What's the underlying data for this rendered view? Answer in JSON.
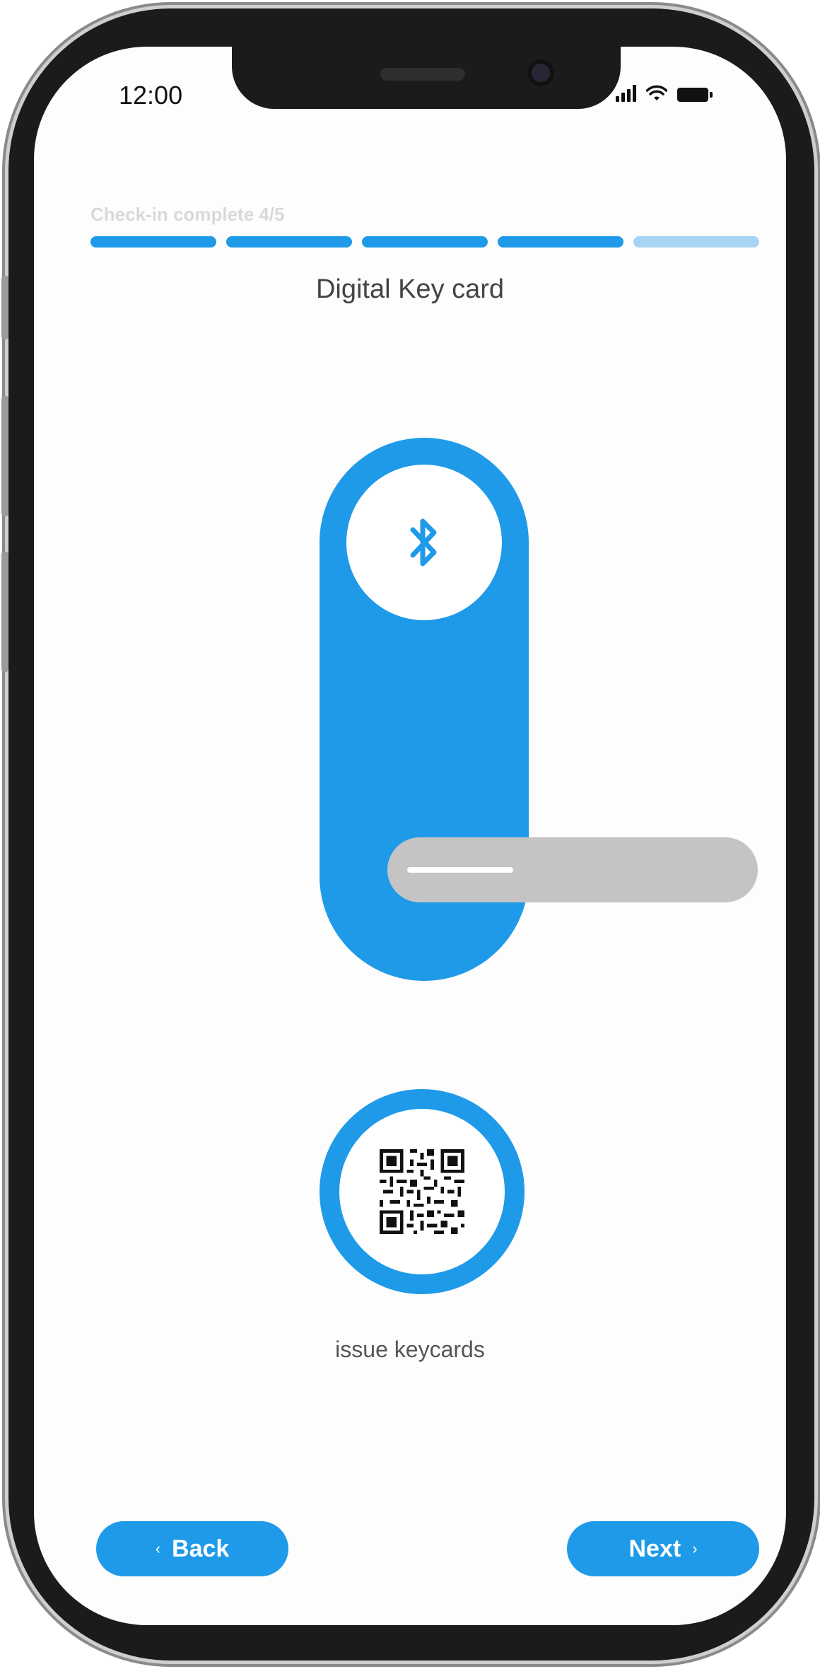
{
  "status_bar": {
    "time": "12:00"
  },
  "progress": {
    "label": "Check-in complete 4/5",
    "steps_total": 5,
    "steps_complete": 4
  },
  "title": "Digital Key card",
  "lock": {
    "icon": "bluetooth-icon"
  },
  "qr": {
    "icon": "qr-code-icon",
    "label": "issue keycards"
  },
  "nav": {
    "back_label": "Back",
    "next_label": "Next",
    "back_icon": "chevron-left-icon",
    "next_icon": "chevron-right-icon"
  },
  "colors": {
    "accent": "#1f9ae8",
    "accent_light": "#a8d4f3",
    "handle": "#c4c4c4"
  }
}
